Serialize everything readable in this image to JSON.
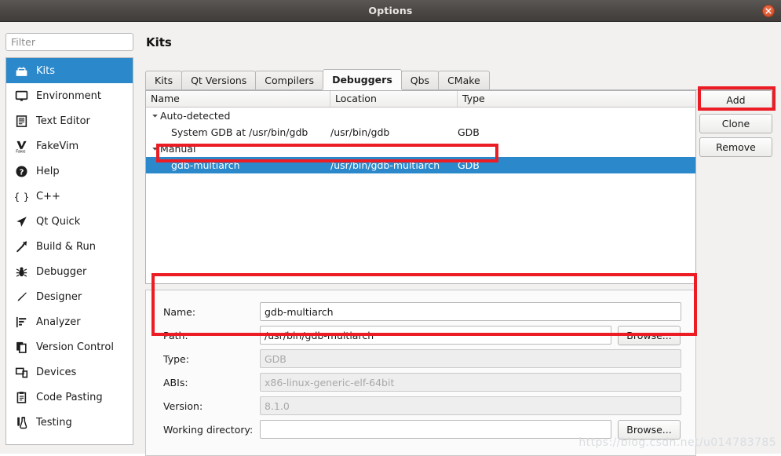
{
  "window": {
    "title": "Options",
    "close_icon": "close-icon"
  },
  "sidebar": {
    "filter_placeholder": "Filter",
    "filter_value": "",
    "items": [
      {
        "label": "Kits",
        "icon": "kits-icon",
        "selected": true
      },
      {
        "label": "Environment",
        "icon": "monitor-icon",
        "selected": false
      },
      {
        "label": "Text Editor",
        "icon": "text-editor-icon",
        "selected": false
      },
      {
        "label": "FakeVim",
        "icon": "fakevim-icon",
        "selected": false
      },
      {
        "label": "Help",
        "icon": "help-question-icon",
        "selected": false
      },
      {
        "label": "C++",
        "icon": "braces-icon",
        "selected": false
      },
      {
        "label": "Qt Quick",
        "icon": "paper-plane-icon",
        "selected": false
      },
      {
        "label": "Build & Run",
        "icon": "hammer-icon",
        "selected": false
      },
      {
        "label": "Debugger",
        "icon": "bug-icon",
        "selected": false
      },
      {
        "label": "Designer",
        "icon": "pencil-icon",
        "selected": false
      },
      {
        "label": "Analyzer",
        "icon": "analyzer-chart-icon",
        "selected": false
      },
      {
        "label": "Version Control",
        "icon": "documents-copy-icon",
        "selected": false
      },
      {
        "label": "Devices",
        "icon": "devices-icon",
        "selected": false
      },
      {
        "label": "Code Pasting",
        "icon": "clipboard-icon",
        "selected": false
      },
      {
        "label": "Testing",
        "icon": "test-tube-icon",
        "selected": false
      }
    ]
  },
  "main": {
    "page_title": "Kits",
    "tabs": [
      {
        "label": "Kits",
        "active": false
      },
      {
        "label": "Qt Versions",
        "active": false
      },
      {
        "label": "Compilers",
        "active": false
      },
      {
        "label": "Debuggers",
        "active": true
      },
      {
        "label": "Qbs",
        "active": false
      },
      {
        "label": "CMake",
        "active": false
      }
    ],
    "tree": {
      "columns": [
        "Name",
        "Location",
        "Type"
      ],
      "rows": [
        {
          "name": "Auto-detected",
          "location": "",
          "type": "",
          "level": 0,
          "group": true,
          "expanded": true,
          "selected": false
        },
        {
          "name": "System GDB at /usr/bin/gdb",
          "location": "/usr/bin/gdb",
          "type": "GDB",
          "level": 1,
          "group": false,
          "expanded": false,
          "selected": false
        },
        {
          "name": "Manual",
          "location": "",
          "type": "",
          "level": 0,
          "group": true,
          "expanded": true,
          "selected": false
        },
        {
          "name": "gdb-multiarch",
          "location": "/usr/bin/gdb-multiarch",
          "type": "GDB",
          "level": 1,
          "group": false,
          "expanded": false,
          "selected": true
        }
      ]
    },
    "buttons": {
      "add": "Add",
      "clone": "Clone",
      "remove": "Remove"
    },
    "details": {
      "fields": [
        {
          "label": "Name:",
          "value": "gdb-multiarch",
          "placeholder": "",
          "readonly": false,
          "browse": false,
          "browse_label": ""
        },
        {
          "label": "Path:",
          "value": "/usr/bin/gdb-multiarch",
          "placeholder": "",
          "readonly": false,
          "browse": true,
          "browse_label": "Browse..."
        },
        {
          "label": "Type:",
          "value": "GDB",
          "placeholder": "",
          "readonly": true,
          "browse": false,
          "browse_label": ""
        },
        {
          "label": "ABIs:",
          "value": "x86-linux-generic-elf-64bit",
          "placeholder": "",
          "readonly": true,
          "browse": false,
          "browse_label": ""
        },
        {
          "label": "Version:",
          "value": "8.1.0",
          "placeholder": "",
          "readonly": true,
          "browse": false,
          "browse_label": ""
        },
        {
          "label": "Working directory:",
          "value": "",
          "placeholder": "",
          "readonly": false,
          "browse": true,
          "browse_label": "Browse..."
        }
      ]
    }
  },
  "watermark": "https://blog.csdn.net/u014783785",
  "colors": {
    "selection_blue": "#2b89cb",
    "annotation_red": "#ec1c24",
    "titlebar_dark": "#4b4846",
    "dialog_bg": "#f2f1f0"
  }
}
